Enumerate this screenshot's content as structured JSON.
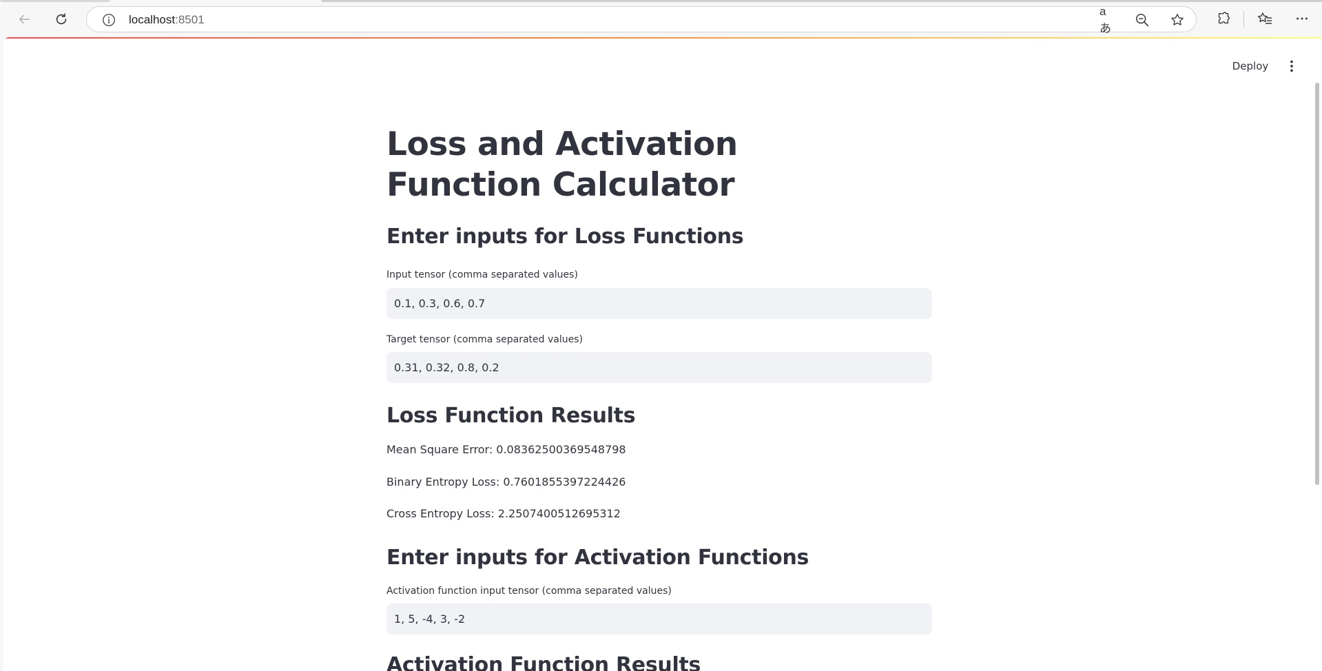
{
  "browser": {
    "url_host": "localhost",
    "url_port": ":8501",
    "read_aloud_glyph": "aあ"
  },
  "app_header": {
    "deploy_label": "Deploy"
  },
  "page": {
    "title": "Loss and Activation Function Calculator",
    "loss_inputs_heading": "Enter inputs for Loss Functions",
    "input_tensor_label": "Input tensor (comma separated values)",
    "input_tensor_value": "0.1, 0.3, 0.6, 0.7",
    "target_tensor_label": "Target tensor (comma separated values)",
    "target_tensor_value": "0.31, 0.32, 0.8, 0.2",
    "loss_results_heading": "Loss Function Results",
    "mse_result": "Mean Square Error: 0.08362500369548798",
    "bce_result": "Binary Entropy Loss: 0.7601855397224426",
    "ce_result": "Cross Entropy Loss: 2.2507400512695312",
    "activation_inputs_heading": "Enter inputs for Activation Functions",
    "activation_tensor_label": "Activation function input tensor (comma separated values)",
    "activation_tensor_value": "1, 5, -4, 3, -2",
    "activation_results_heading": "Activation Function Results"
  },
  "colors": {
    "text": "#31333f",
    "input_bg": "#f0f2f6",
    "decoration_start": "#ff4b4b",
    "decoration_end": "#fffd80"
  }
}
